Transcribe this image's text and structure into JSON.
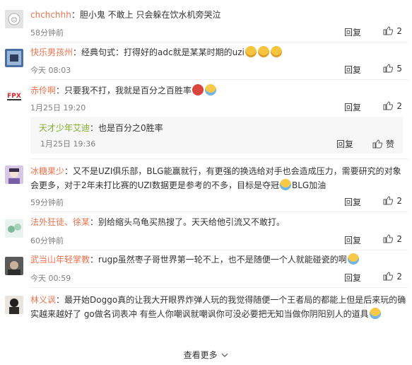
{
  "comments": [
    {
      "username": "chchchhh",
      "text": "胆小鬼 不敢上 只会躲在饮水机旁哭泣",
      "time": "58分钟前",
      "reply": "回复",
      "likes": "2"
    },
    {
      "username": "快乐男孩州",
      "text": "经典句式：打得好的adc就是某某时期的uzi",
      "time": "今天 08:03",
      "reply": "回复",
      "likes": "5"
    },
    {
      "username": "赤伶啊",
      "text": "只要我不打，我就是百分之百胜率",
      "time": "1月25日 19:20",
      "reply": "回复",
      "likes": "2",
      "subreply": {
        "username": "天才少年艾迪",
        "text": "也是百分之0胜率",
        "time": "1月25日 19:36",
        "reply": "回复",
        "likes": "赞"
      }
    },
    {
      "username": "冰糖果少",
      "text": "又不是UZI俱乐部，BLG能赢就行，有更强的换选给对手也会造成压力，需要研究的对象会更多，对于2年未打比赛的UZI数据更是参考的不多，目标是夺冠",
      "text_tail": "BLG加油",
      "time": "59分钟前",
      "reply": "回复",
      "likes": "2"
    },
    {
      "username": "法外狂徒、徐某",
      "text": "别给缩头乌龟买热搜了。天天给他引流又不敢打。",
      "time": "60分钟前",
      "reply": "回复",
      "likes": "2"
    },
    {
      "username": "武当山年轻掌教",
      "text": "rugp虽然枣子哥世界第一轮不上，也不是随便一个人就能碰瓷的啊",
      "time": "今天 00:59",
      "reply": "回复",
      "likes": "2"
    },
    {
      "username": "林义讽",
      "text": "最开始Doggo真的让我大开眼界炸弹人玩的我觉得随便一个王者局的都能上但是后来玩的确实越来越好了 go做名词表冲 有些人你嘲讽就嘲讽你可没必要把无知当做你阴阳别人的道具",
      "time": "",
      "reply": "",
      "likes": ""
    }
  ],
  "more_label": "查看更多",
  "colors": {
    "username": "#eb7350",
    "meta": "#808080",
    "divider": "#eeeeee",
    "subreply_bg": "#f7f7f7"
  }
}
